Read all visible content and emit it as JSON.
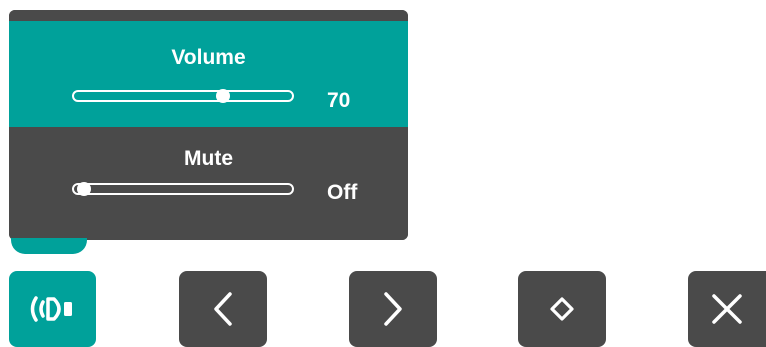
{
  "osd": {
    "volume": {
      "label": "Volume",
      "value": "70",
      "level": 0.7
    },
    "mute": {
      "label": "Mute",
      "value": "Off",
      "level": 0.0
    }
  },
  "buttons": [
    {
      "name": "audio-input-button",
      "icon": "audio-input-icon"
    },
    {
      "name": "left-button",
      "icon": "chevron-left-icon"
    },
    {
      "name": "right-button",
      "icon": "chevron-right-icon"
    },
    {
      "name": "up-down-button",
      "icon": "up-down-icon"
    },
    {
      "name": "close-button",
      "icon": "close-icon"
    }
  ],
  "colors": {
    "accent": "#00a19a",
    "panel": "#4a4a4a",
    "text": "#ffffff"
  }
}
